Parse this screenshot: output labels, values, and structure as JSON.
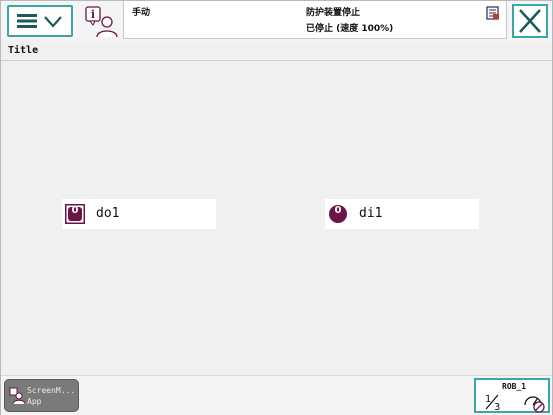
{
  "header": {
    "mode": "手动",
    "status_line1": "防护装置停止",
    "status_line2": "已停止 (速度 100%)"
  },
  "page": {
    "title": "Title"
  },
  "signals": [
    {
      "badge": "0",
      "name": "do1"
    },
    {
      "badge": "0",
      "name": "di1"
    }
  ],
  "taskbar": {
    "app_line1": "ScreenM...",
    "app_line2": "App",
    "robot": "ROB_1"
  },
  "colors": {
    "accent": "#3aa6a6",
    "signal_badge": "#6b1446",
    "background": "#f0f0f0"
  }
}
